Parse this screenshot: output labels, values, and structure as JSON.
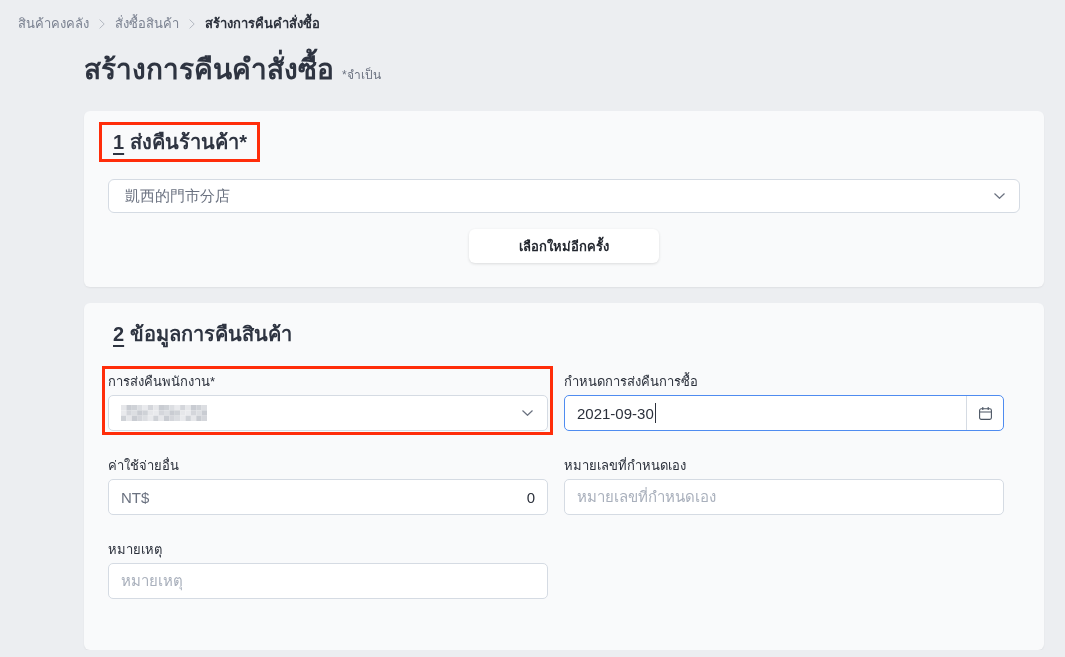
{
  "breadcrumb": [
    {
      "label": "สินค้าคงคลัง",
      "current": false
    },
    {
      "label": "สั่งซื้อสินค้า",
      "current": false
    },
    {
      "label": "สร้างการคืนคำสั่งซื้อ",
      "current": true
    }
  ],
  "page": {
    "title": "สร้างการคืนคำสั่งซื้อ",
    "required_note": "*จำเป็น"
  },
  "store_section": {
    "number": "1",
    "title": "ส่งคืนร้านค้า*",
    "highlighted": true,
    "store_select": {
      "value": "凱西的門市分店"
    },
    "reselect_button": "เลือกใหม่อีกครั้ง"
  },
  "details_section": {
    "number": "2",
    "title": "ข้อมูลการคืนสินค้า",
    "highlighted": false,
    "fields": [
      {
        "kind": "select",
        "label": "การส่งคืนพนักงาน*",
        "redacted": true,
        "highlighted": true,
        "focused": false
      },
      {
        "kind": "date",
        "label": "กำหนดการส่งคืนการซื้อ",
        "value": "2021-09-30",
        "highlighted": false,
        "focused": true
      },
      {
        "kind": "currency",
        "label": "ค่าใช้จ่ายอื่น",
        "prefix": "NT$",
        "value": "0",
        "highlighted": false,
        "focused": false
      },
      {
        "kind": "text",
        "label": "หมายเลขที่กำหนดเอง",
        "placeholder": "หมายเลขที่กำหนดเอง",
        "highlighted": false,
        "focused": false
      },
      {
        "kind": "text",
        "label": "หมายเหตุ",
        "placeholder": "หมายเหตุ",
        "highlighted": false,
        "focused": false
      }
    ]
  }
}
